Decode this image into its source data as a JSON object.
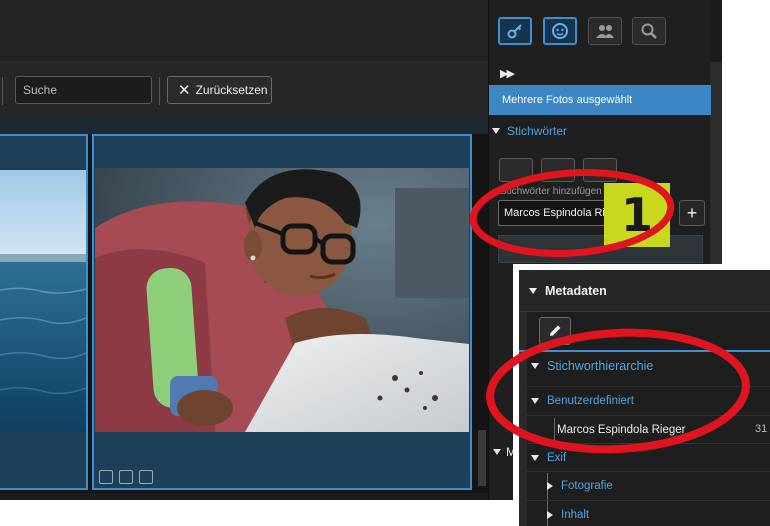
{
  "toolbar": {
    "search_placeholder": "Suche",
    "reset_label": "Zurücksetzen"
  },
  "right_panel": {
    "mode_icons": [
      "key-icon",
      "face-icon",
      "people-icon",
      "zoom-icon"
    ],
    "multi_select_banner": "Mehrere Fotos ausgewählt",
    "keywords_section": "Stichwörter",
    "keywords_add_label": "Stichwörter hinzufügen",
    "keywords_input_value": "Marcos Espindola Rieger",
    "add_button": "+",
    "keywords_area_text": "...",
    "bottom_section_letter": "M"
  },
  "callout": {
    "number": "1"
  },
  "overlay": {
    "header": "Metadaten",
    "hierarchy_title": "Stichworthierarchie",
    "custom_group": "Benutzerdefiniert",
    "keyword_entry": "Marcos Espindola Rieger",
    "keyword_count_truncated": "31",
    "exif_group_truncated": "Exif",
    "photography": "Fotografie",
    "content": "Inhalt"
  },
  "colors": {
    "accent_blue": "#3d8fd1",
    "banner_blue": "#3d86c6",
    "annotation_red": "#e0141e",
    "callout_yellow": "#c8d81c",
    "panel_dark": "#1f1f1f"
  }
}
